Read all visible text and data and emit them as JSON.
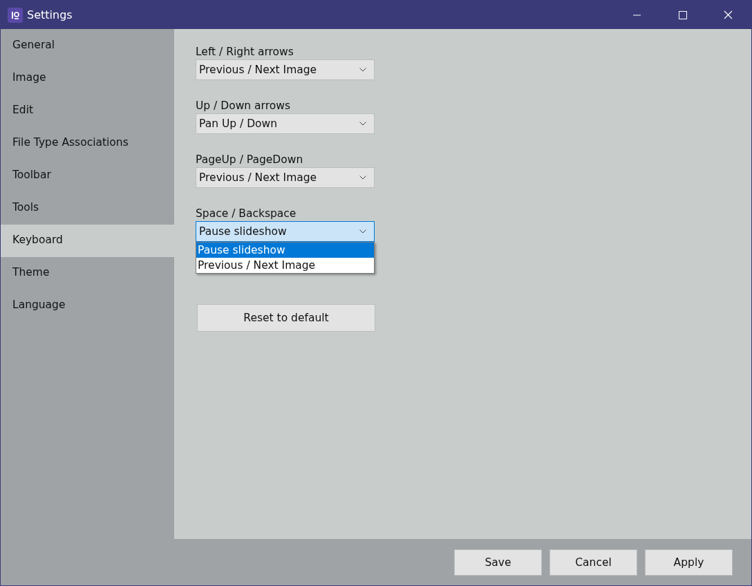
{
  "window": {
    "title": "Settings"
  },
  "sidebar": {
    "items": [
      {
        "label": "General",
        "selected": false
      },
      {
        "label": "Image",
        "selected": false
      },
      {
        "label": "Edit",
        "selected": false
      },
      {
        "label": "File Type Associations",
        "selected": false
      },
      {
        "label": "Toolbar",
        "selected": false
      },
      {
        "label": "Tools",
        "selected": false
      },
      {
        "label": "Keyboard",
        "selected": true
      },
      {
        "label": "Theme",
        "selected": false
      },
      {
        "label": "Language",
        "selected": false
      }
    ]
  },
  "settings": [
    {
      "label": "Left / Right arrows",
      "value": "Previous / Next Image",
      "expanded": false
    },
    {
      "label": "Up / Down arrows",
      "value": "Pan Up / Down",
      "expanded": false
    },
    {
      "label": "PageUp / PageDown",
      "value": "Previous / Next Image",
      "expanded": false
    },
    {
      "label": "Space / Backspace",
      "value": "Pause slideshow",
      "expanded": true,
      "options": [
        {
          "label": "Pause slideshow",
          "selected": true
        },
        {
          "label": "Previous / Next Image",
          "selected": false
        }
      ]
    }
  ],
  "reset_button": "Reset to default",
  "footer_buttons": [
    "Save",
    "Cancel",
    "Apply"
  ]
}
